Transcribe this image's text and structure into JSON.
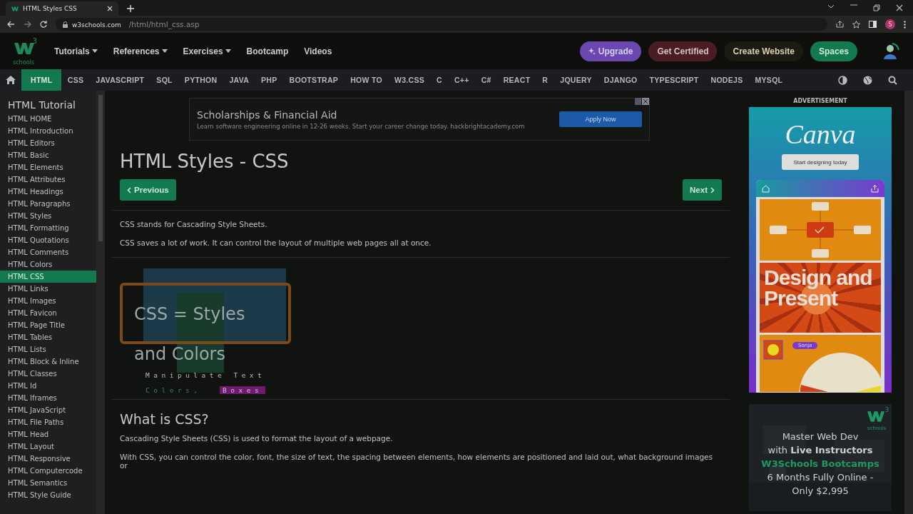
{
  "browser": {
    "tab_title": "HTML Styles CSS",
    "url_domain": "w3schools.com",
    "url_path": "/html/html_css.asp",
    "profile_initial": "S"
  },
  "topnav": {
    "logo_sup": "3",
    "logo_text": "schools",
    "menu": [
      {
        "label": "Tutorials",
        "dropdown": true
      },
      {
        "label": "References",
        "dropdown": true
      },
      {
        "label": "Exercises",
        "dropdown": true
      },
      {
        "label": "Bootcamp",
        "dropdown": false
      },
      {
        "label": "Videos",
        "dropdown": false
      }
    ],
    "actions": [
      {
        "label": "Upgrade",
        "kind": "upgrade"
      },
      {
        "label": "Get Certified",
        "kind": "certified"
      },
      {
        "label": "Create Website",
        "kind": "create"
      },
      {
        "label": "Spaces",
        "kind": "spaces"
      }
    ]
  },
  "subnav": [
    {
      "label": "HTML",
      "selected": true
    },
    {
      "label": "CSS",
      "selected": false
    },
    {
      "label": "JAVASCRIPT",
      "selected": false
    },
    {
      "label": "SQL",
      "selected": false
    },
    {
      "label": "PYTHON",
      "selected": false
    },
    {
      "label": "JAVA",
      "selected": false
    },
    {
      "label": "PHP",
      "selected": false
    },
    {
      "label": "BOOTSTRAP",
      "selected": false
    },
    {
      "label": "HOW TO",
      "selected": false
    },
    {
      "label": "W3.CSS",
      "selected": false
    },
    {
      "label": "C",
      "selected": false
    },
    {
      "label": "C++",
      "selected": false
    },
    {
      "label": "C#",
      "selected": false
    },
    {
      "label": "REACT",
      "selected": false
    },
    {
      "label": "R",
      "selected": false
    },
    {
      "label": "JQUERY",
      "selected": false
    },
    {
      "label": "DJANGO",
      "selected": false
    },
    {
      "label": "TYPESCRIPT",
      "selected": false
    },
    {
      "label": "NODEJS",
      "selected": false
    },
    {
      "label": "MYSQL",
      "selected": false
    }
  ],
  "sidebar": {
    "title": "HTML Tutorial",
    "items": [
      {
        "label": "HTML HOME",
        "selected": false
      },
      {
        "label": "HTML Introduction",
        "selected": false
      },
      {
        "label": "HTML Editors",
        "selected": false
      },
      {
        "label": "HTML Basic",
        "selected": false
      },
      {
        "label": "HTML Elements",
        "selected": false
      },
      {
        "label": "HTML Attributes",
        "selected": false
      },
      {
        "label": "HTML Headings",
        "selected": false
      },
      {
        "label": "HTML Paragraphs",
        "selected": false
      },
      {
        "label": "HTML Styles",
        "selected": false
      },
      {
        "label": "HTML Formatting",
        "selected": false
      },
      {
        "label": "HTML Quotations",
        "selected": false
      },
      {
        "label": "HTML Comments",
        "selected": false
      },
      {
        "label": "HTML Colors",
        "selected": false
      },
      {
        "label": "HTML CSS",
        "selected": true
      },
      {
        "label": "HTML Links",
        "selected": false
      },
      {
        "label": "HTML Images",
        "selected": false
      },
      {
        "label": "HTML Favicon",
        "selected": false
      },
      {
        "label": "HTML Page Title",
        "selected": false
      },
      {
        "label": "HTML Tables",
        "selected": false
      },
      {
        "label": "HTML Lists",
        "selected": false
      },
      {
        "label": "HTML Block & Inline",
        "selected": false
      },
      {
        "label": "HTML Classes",
        "selected": false
      },
      {
        "label": "HTML Id",
        "selected": false
      },
      {
        "label": "HTML Iframes",
        "selected": false
      },
      {
        "label": "HTML JavaScript",
        "selected": false
      },
      {
        "label": "HTML File Paths",
        "selected": false
      },
      {
        "label": "HTML Head",
        "selected": false
      },
      {
        "label": "HTML Layout",
        "selected": false
      },
      {
        "label": "HTML Responsive",
        "selected": false
      },
      {
        "label": "HTML Computercode",
        "selected": false
      },
      {
        "label": "HTML Semantics",
        "selected": false
      },
      {
        "label": "HTML Style Guide",
        "selected": false
      }
    ]
  },
  "ad_banner": {
    "title": "Scholarships & Financial Aid",
    "text": "Learn software engineering online in 12-26 weeks. Start your career change today. hackbrightacademy.com",
    "button": "Apply Now"
  },
  "page": {
    "title": "HTML Styles - CSS",
    "prev": "Previous",
    "next": "Next",
    "intro": [
      "CSS stands for Cascading Style Sheets.",
      "CSS saves a lot of work. It can control the layout of multiple web pages all at once."
    ],
    "hero": {
      "line1": "CSS = Styles",
      "line2": "and Colors",
      "text1": "Manipulate Text",
      "text2": "Colors,",
      "text3": "Boxes"
    },
    "section_title": "What is CSS?",
    "section_paragraphs": [
      "Cascading Style Sheets (CSS) is used to format the layout of a webpage.",
      "With CSS, you can control the color, font, the size of text, the spacing between elements, how elements are positioned and laid out, what background images or"
    ]
  },
  "right": {
    "label": "ADVERTISEMENT",
    "canva": {
      "brand": "Canva",
      "button": "Start designing today",
      "headline": "Design and Present",
      "tag": "Sonja"
    },
    "bootcamp": {
      "logo_sup": "3",
      "logo_text": "schools",
      "lines": [
        "Master Web Dev",
        "with **Live Instructors**",
        "W3Schools Bootcamps",
        "6 Months Fully Online -",
        "Only $2,995"
      ]
    }
  }
}
